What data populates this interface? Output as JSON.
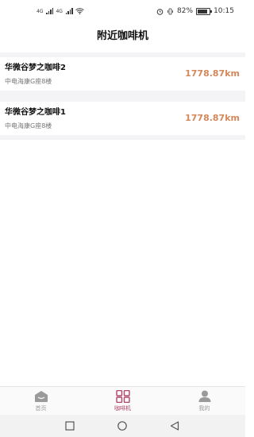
{
  "status_bar": {
    "signal1_label": "4G",
    "signal2_label": "4G",
    "battery_percent": "82%",
    "battery_level": 0.82,
    "time": "10:15"
  },
  "page": {
    "title": "附近咖啡机"
  },
  "machines": [
    {
      "name": "华微谷梦之咖啡2",
      "address": "中电海康G座8楼",
      "distance": "1778.87km"
    },
    {
      "name": "华微谷梦之咖啡1",
      "address": "中电海康G座8楼",
      "distance": "1778.87km"
    }
  ],
  "tabbar": {
    "items": [
      {
        "label": "首页",
        "icon": "home-icon"
      },
      {
        "label": "咖啡机",
        "icon": "grid-icon"
      },
      {
        "label": "我的",
        "icon": "user-icon"
      }
    ],
    "active_index": 1,
    "active_color": "#b0476b",
    "inactive_color": "#999999"
  },
  "colors": {
    "distance": "#d4875a",
    "list_background": "#f4f4f6"
  }
}
